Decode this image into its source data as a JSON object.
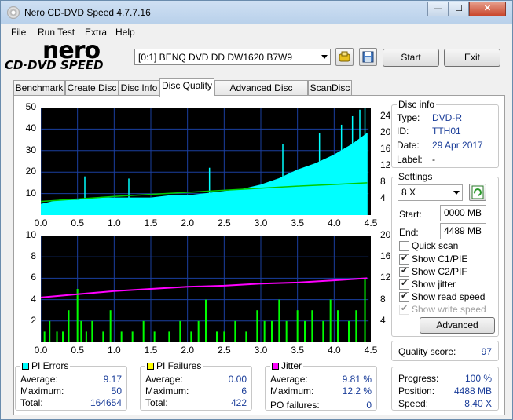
{
  "window": {
    "title": "Nero CD-DVD Speed 4.7.7.16",
    "minimize": "—",
    "maximize": "☐",
    "close": "✕"
  },
  "menu": [
    "File",
    "Run Test",
    "Extra",
    "Help"
  ],
  "logo": {
    "line1": "nero",
    "line2": "CD·DVD SPEED"
  },
  "drive": {
    "selected": "[0:1]  BENQ DVD DD DW1620 B7W9"
  },
  "toolbar": {
    "start": "Start",
    "exit": "Exit"
  },
  "tabs": [
    "Benchmark",
    "Create Disc",
    "Disc Info",
    "Disc Quality",
    "Advanced Disc Quality",
    "ScanDisc"
  ],
  "active_tab": "Disc Quality",
  "disc_info": {
    "title": "Disc info",
    "type_label": "Type:",
    "type": "DVD-R",
    "id_label": "ID:",
    "id": "TTH01",
    "date_label": "Date:",
    "date": "29 Apr 2017",
    "label_label": "Label:",
    "label": "-"
  },
  "settings": {
    "title": "Settings",
    "speed": "8 X",
    "start_label": "Start:",
    "start": "0000 MB",
    "end_label": "End:",
    "end": "4489 MB",
    "quick_scan": "Quick scan",
    "show_c1": "Show C1/PIE",
    "show_c2": "Show C2/PIF",
    "show_jitter": "Show jitter",
    "show_read": "Show read speed",
    "show_write": "Show write speed",
    "advanced": "Advanced"
  },
  "quality": {
    "label": "Quality score:",
    "value": "97"
  },
  "progress": {
    "progress_label": "Progress:",
    "progress": "100 %",
    "position_label": "Position:",
    "position": "4488 MB",
    "speed_label": "Speed:",
    "speed": "8.40 X"
  },
  "pi_errors": {
    "title": "PI Errors",
    "color": "#00ffff",
    "avg_label": "Average:",
    "avg": "9.17",
    "max_label": "Maximum:",
    "max": "50",
    "total_label": "Total:",
    "total": "164654"
  },
  "pi_failures": {
    "title": "PI Failures",
    "color": "#ffff00",
    "avg_label": "Average:",
    "avg": "0.00",
    "max_label": "Maximum:",
    "max": "6",
    "total_label": "Total:",
    "total": "422"
  },
  "jitter": {
    "title": "Jitter",
    "color": "#ff00ff",
    "avg_label": "Average:",
    "avg": "9.81 %",
    "max_label": "Maximum:",
    "max": "12.2 %",
    "po_label": "PO failures:",
    "po": "0"
  },
  "chart_data": [
    {
      "type": "area",
      "x_ticks": [
        "0.0",
        "0.5",
        "1.0",
        "1.5",
        "2.0",
        "2.5",
        "3.0",
        "3.5",
        "4.0",
        "4.5"
      ],
      "y_left_ticks": [
        "10",
        "20",
        "30",
        "40",
        "50"
      ],
      "y_right_ticks": [
        "4",
        "8",
        "12",
        "16",
        "20",
        "24"
      ],
      "xlim": [
        0,
        4.5
      ],
      "ylim_left": [
        0,
        50
      ],
      "ylim_right": [
        0,
        26
      ],
      "series": [
        {
          "name": "PI Errors",
          "color": "#00ffff",
          "x": [
            0,
            0.25,
            0.5,
            0.75,
            1.0,
            1.25,
            1.5,
            1.75,
            2.0,
            2.25,
            2.5,
            2.75,
            3.0,
            3.25,
            3.5,
            3.75,
            4.0,
            4.25,
            4.45
          ],
          "values": [
            5,
            7,
            7,
            8,
            8,
            8,
            8,
            9,
            9,
            10,
            11,
            12,
            14,
            17,
            21,
            24,
            28,
            33,
            38
          ]
        },
        {
          "name": "Read Speed",
          "color": "#00cc00",
          "x": [
            0,
            0.5,
            1.0,
            1.5,
            2.0,
            2.5,
            3.0,
            3.5,
            4.0,
            4.45
          ],
          "values": [
            3.3,
            3.9,
            4.5,
            5.0,
            5.5,
            6.0,
            6.5,
            7.0,
            7.4,
            7.8
          ]
        }
      ],
      "spikes": {
        "x": [
          0.6,
          1.2,
          2.3,
          3.3,
          3.8,
          4.1,
          4.25,
          4.35,
          4.42
        ],
        "values": [
          18,
          17,
          22,
          33,
          38,
          42,
          46,
          49,
          50
        ]
      }
    },
    {
      "type": "bar",
      "x_ticks": [
        "0.0",
        "0.5",
        "1.0",
        "1.5",
        "2.0",
        "2.5",
        "3.0",
        "3.5",
        "4.0",
        "4.5"
      ],
      "y_left_ticks": [
        "2",
        "4",
        "6",
        "8",
        "10"
      ],
      "y_right_ticks": [
        "4",
        "8",
        "12",
        "16",
        "20"
      ],
      "xlim": [
        0,
        4.5
      ],
      "ylim_left": [
        0,
        10
      ],
      "ylim_right": [
        0,
        20
      ],
      "series": [
        {
          "name": "PI Failures",
          "color": "#00ff00",
          "x": [
            0.05,
            0.12,
            0.22,
            0.3,
            0.38,
            0.5,
            0.55,
            0.62,
            0.7,
            0.85,
            0.95,
            1.1,
            1.25,
            1.4,
            1.55,
            1.75,
            1.9,
            2.05,
            2.15,
            2.25,
            2.4,
            2.5,
            2.65,
            2.8,
            2.95,
            3.05,
            3.15,
            3.25,
            3.35,
            3.5,
            3.6,
            3.7,
            3.85,
            3.95,
            4.05,
            4.2,
            4.3,
            4.42
          ],
          "values": [
            1,
            2,
            1,
            1,
            3,
            5,
            2,
            1,
            2,
            1,
            3,
            1,
            1,
            2,
            1,
            1,
            2,
            1,
            2,
            4,
            1,
            1,
            2,
            1,
            3,
            2,
            2,
            4,
            2,
            3,
            2,
            3,
            2,
            4,
            3,
            2,
            3,
            6
          ]
        },
        {
          "name": "Jitter",
          "color": "#ff00ff",
          "x": [
            0,
            0.5,
            1.0,
            1.5,
            2.0,
            2.5,
            3.0,
            3.5,
            4.0,
            4.45
          ],
          "values": [
            4.2,
            4.5,
            4.8,
            5.0,
            5.2,
            5.3,
            5.5,
            5.6,
            5.8,
            6.0
          ]
        }
      ]
    }
  ]
}
